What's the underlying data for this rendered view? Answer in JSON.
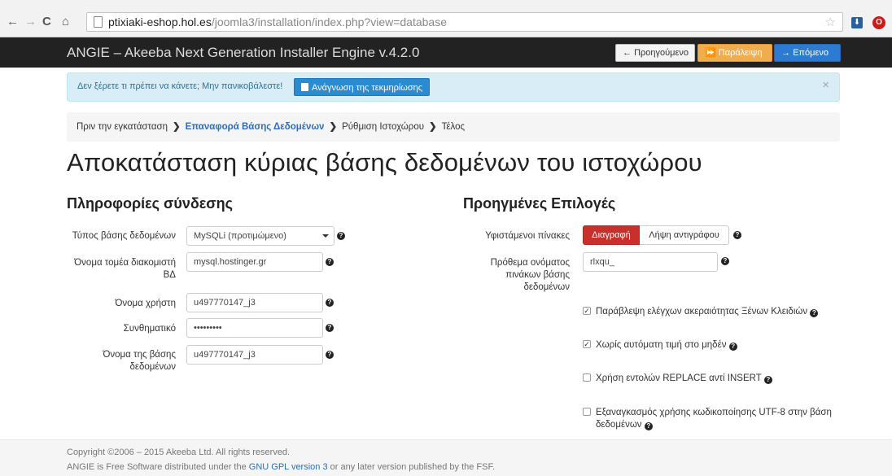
{
  "browser": {
    "url_host": "ptixiaki-eshop.hol.es",
    "url_path": "/joomla3/installation/index.php?view=database"
  },
  "header": {
    "brand": "ANGIE – Akeeba Next Generation Installer Engine v.4.2.0",
    "prev_label": "Προηγούμενο",
    "skip_label": "Παράλειψη",
    "next_label": "Επόμενο"
  },
  "alert": {
    "text": "Δεν ξέρετε τι πρέπει να κάνετε; Μην πανικοβάλεστε!",
    "button_label": "Ανάγνωση της τεκμηρίωσης",
    "close": "×"
  },
  "breadcrumb": {
    "items": [
      "Πριν την εγκατάσταση",
      "Επαναφορά Βάσης Δεδομένων",
      "Ρύθμιση Ιστοχώρου",
      "Τέλος"
    ],
    "active_index": 1
  },
  "page": {
    "title": "Αποκατάσταση κύριας βάσης δεδομένων του ιστοχώρου",
    "left_heading": "Πληροφορίες σύνδεσης",
    "right_heading": "Προηγμένες Επιλογές"
  },
  "connection": {
    "db_type_label": "Τύπος βάσης δεδομένων",
    "db_type_value": "MySQLi (προτιμώμενο)",
    "host_label": "Όνομα τομέα διακομιστή ΒΔ",
    "host_value": "mysql.hostinger.gr",
    "user_label": "Όνομα χρήστη",
    "user_value": "u497770147_j3",
    "password_label": "Συνθηματικό",
    "password_value": "•••••••••",
    "dbname_label": "Όνομα της βάσης δεδομένων",
    "dbname_value": "u497770147_j3"
  },
  "advanced": {
    "existing_label": "Υφιστάμενοι πίνακες",
    "delete_label": "Διαγραφή",
    "backup_label": "Λήψη αντιγράφου",
    "prefix_label": "Πρόθεμα ονόματος πινάκων βάσης δεδομένων",
    "prefix_value": "rlxqu_",
    "checkboxes": [
      {
        "label": "Παράβλεψη ελέγχων ακεραιότητας Ξένων Κλειδιών",
        "checked": true
      },
      {
        "label": "Χωρίς αυτόματη τιμή στο μηδέν",
        "checked": true
      },
      {
        "label": "Χρήση εντολών REPLACE αντί INSERT",
        "checked": false
      },
      {
        "label": "Εξαναγκασμός χρήσης κωδικοποίησης UTF-8 στην βάση δεδομένων",
        "checked": false
      }
    ]
  },
  "footer": {
    "copyright": "Copyright ©2006 – 2015 Akeeba Ltd. All rights reserved.",
    "license_pre": "ANGIE is Free Software distributed under the",
    "license_link": "GNU GPL version 3",
    "license_post": "or any later version published by the FSF."
  }
}
